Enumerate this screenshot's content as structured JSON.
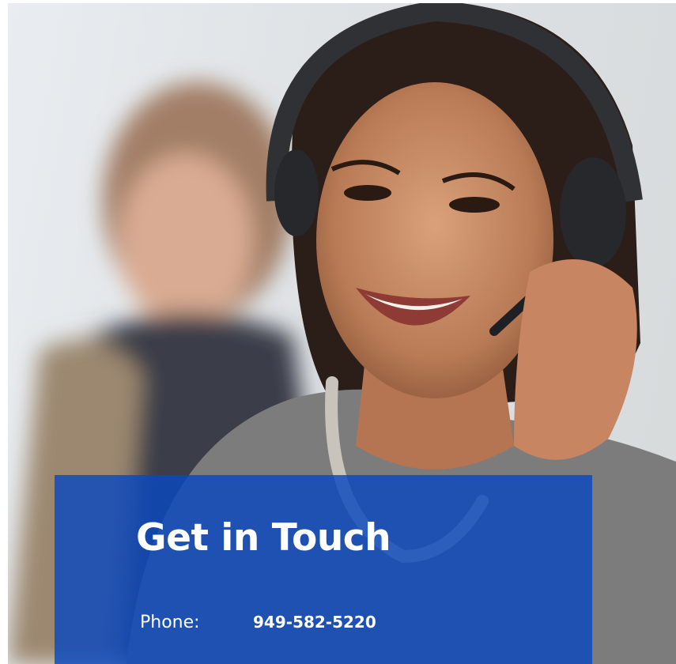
{
  "hero": {
    "image_icon": "customer-service-agent-photo",
    "colors": {
      "card_background": "#0a48be",
      "card_text": "#ffffff"
    }
  },
  "contact": {
    "title": "Get in Touch",
    "phone_label": "Phone:",
    "phone_number": "949-582-5220"
  }
}
